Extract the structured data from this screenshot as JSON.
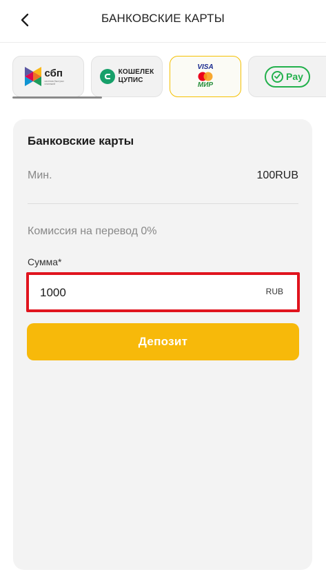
{
  "header": {
    "title": "БАНКОВСКИЕ КАРТЫ",
    "back_icon": "chevron-left-icon"
  },
  "payment_methods": [
    {
      "id": "sbp",
      "label": "сбп",
      "sublabel": "система быстрых платежей",
      "icon": "sbp-logo-icon",
      "selected": true
    },
    {
      "id": "cupis",
      "label_line1": "КОШЕЛЕК",
      "label_line2": "ЦУПИС",
      "icon": "cupis-logo-icon",
      "brand_color": "#17a06a"
    },
    {
      "id": "cards",
      "label_top": "VISA",
      "label_bottom": "МИР",
      "icon": "visa-mastercard-mir-icon",
      "highlighted": true,
      "accent": "#f5c000"
    },
    {
      "id": "pay",
      "label": "Pay",
      "icon": "check-circle-icon",
      "brand_color": "#21b04b"
    }
  ],
  "form": {
    "title": "Банковские карты",
    "min_label": "Мин.",
    "min_value": "100RUB",
    "commission": "Комиссия на перевод 0%",
    "amount_label": "Сумма*",
    "amount_value": "1000",
    "currency": "RUB",
    "submit_label": "Депозит",
    "submit_color": "#f7b90a",
    "highlight_color": "#e0141e"
  }
}
